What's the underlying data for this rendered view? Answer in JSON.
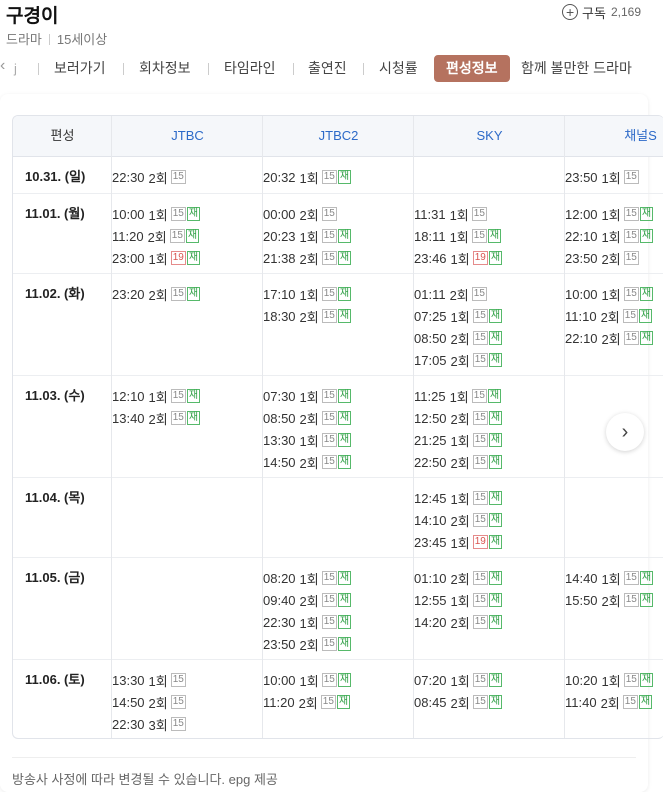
{
  "header": {
    "title": "구경이",
    "genre": "드라마",
    "rating": "15세이상",
    "subscribe_label": "구독",
    "subscribe_count": "2,169"
  },
  "tabs": [
    "보러가기",
    "회차정보",
    "타임라인",
    "출연진",
    "시청률",
    "편성정보",
    "함께 볼만한 드라마"
  ],
  "tab_left_partial": "j",
  "active_tab": "편성정보",
  "schedule": {
    "header_first": "편성",
    "channels": [
      "JTBC",
      "JTBC2",
      "SKY",
      "채널S"
    ],
    "rows": [
      {
        "date": "10.31. (일)",
        "cells": [
          [
            {
              "time": "22:30",
              "ep": "2회",
              "badges": [
                "15"
              ]
            }
          ],
          [
            {
              "time": "20:32",
              "ep": "1회",
              "badges": [
                "15",
                "재"
              ]
            }
          ],
          [],
          [
            {
              "time": "23:50",
              "ep": "1회",
              "badges": [
                "15"
              ]
            }
          ]
        ]
      },
      {
        "date": "11.01. (월)",
        "cells": [
          [
            {
              "time": "10:00",
              "ep": "1회",
              "badges": [
                "15",
                "재"
              ]
            },
            {
              "time": "11:20",
              "ep": "2회",
              "badges": [
                "15",
                "재"
              ]
            },
            {
              "time": "23:00",
              "ep": "1회",
              "badges": [
                "19",
                "재"
              ]
            }
          ],
          [
            {
              "time": "00:00",
              "ep": "2회",
              "badges": [
                "15"
              ]
            },
            {
              "time": "20:23",
              "ep": "1회",
              "badges": [
                "15",
                "재"
              ]
            },
            {
              "time": "21:38",
              "ep": "2회",
              "badges": [
                "15",
                "재"
              ]
            }
          ],
          [
            {
              "time": "11:31",
              "ep": "1회",
              "badges": [
                "15"
              ]
            },
            {
              "time": "18:11",
              "ep": "1회",
              "badges": [
                "15",
                "재"
              ]
            },
            {
              "time": "23:46",
              "ep": "1회",
              "badges": [
                "19",
                "재"
              ]
            }
          ],
          [
            {
              "time": "12:00",
              "ep": "1회",
              "badges": [
                "15",
                "재"
              ]
            },
            {
              "time": "22:10",
              "ep": "1회",
              "badges": [
                "15",
                "재"
              ]
            },
            {
              "time": "23:50",
              "ep": "2회",
              "badges": [
                "15"
              ]
            }
          ]
        ]
      },
      {
        "date": "11.02. (화)",
        "cells": [
          [
            {
              "time": "23:20",
              "ep": "2회",
              "badges": [
                "15",
                "재"
              ]
            }
          ],
          [
            {
              "time": "17:10",
              "ep": "1회",
              "badges": [
                "15",
                "재"
              ]
            },
            {
              "time": "18:30",
              "ep": "2회",
              "badges": [
                "15",
                "재"
              ]
            }
          ],
          [
            {
              "time": "01:11",
              "ep": "2회",
              "badges": [
                "15"
              ]
            },
            {
              "time": "07:25",
              "ep": "1회",
              "badges": [
                "15",
                "재"
              ]
            },
            {
              "time": "08:50",
              "ep": "2회",
              "badges": [
                "15",
                "재"
              ]
            },
            {
              "time": "17:05",
              "ep": "2회",
              "badges": [
                "15",
                "재"
              ]
            }
          ],
          [
            {
              "time": "10:00",
              "ep": "1회",
              "badges": [
                "15",
                "재"
              ]
            },
            {
              "time": "11:10",
              "ep": "2회",
              "badges": [
                "15",
                "재"
              ]
            },
            {
              "time": "22:10",
              "ep": "2회",
              "badges": [
                "15",
                "재"
              ]
            }
          ]
        ]
      },
      {
        "date": "11.03. (수)",
        "cells": [
          [
            {
              "time": "12:10",
              "ep": "1회",
              "badges": [
                "15",
                "재"
              ]
            },
            {
              "time": "13:40",
              "ep": "2회",
              "badges": [
                "15",
                "재"
              ]
            }
          ],
          [
            {
              "time": "07:30",
              "ep": "1회",
              "badges": [
                "15",
                "재"
              ]
            },
            {
              "time": "08:50",
              "ep": "2회",
              "badges": [
                "15",
                "재"
              ]
            },
            {
              "time": "13:30",
              "ep": "1회",
              "badges": [
                "15",
                "재"
              ]
            },
            {
              "time": "14:50",
              "ep": "2회",
              "badges": [
                "15",
                "재"
              ]
            }
          ],
          [
            {
              "time": "11:25",
              "ep": "1회",
              "badges": [
                "15",
                "재"
              ]
            },
            {
              "time": "12:50",
              "ep": "2회",
              "badges": [
                "15",
                "재"
              ]
            },
            {
              "time": "21:25",
              "ep": "1회",
              "badges": [
                "15",
                "재"
              ]
            },
            {
              "time": "22:50",
              "ep": "2회",
              "badges": [
                "15",
                "재"
              ]
            }
          ],
          []
        ]
      },
      {
        "date": "11.04. (목)",
        "cells": [
          [],
          [],
          [
            {
              "time": "12:45",
              "ep": "1회",
              "badges": [
                "15",
                "재"
              ]
            },
            {
              "time": "14:10",
              "ep": "2회",
              "badges": [
                "15",
                "재"
              ]
            },
            {
              "time": "23:45",
              "ep": "1회",
              "badges": [
                "19",
                "재"
              ]
            }
          ],
          []
        ]
      },
      {
        "date": "11.05. (금)",
        "cells": [
          [],
          [
            {
              "time": "08:20",
              "ep": "1회",
              "badges": [
                "15",
                "재"
              ]
            },
            {
              "time": "09:40",
              "ep": "2회",
              "badges": [
                "15",
                "재"
              ]
            },
            {
              "time": "22:30",
              "ep": "1회",
              "badges": [
                "15",
                "재"
              ]
            },
            {
              "time": "23:50",
              "ep": "2회",
              "badges": [
                "15",
                "재"
              ]
            }
          ],
          [
            {
              "time": "01:10",
              "ep": "2회",
              "badges": [
                "15",
                "재"
              ]
            },
            {
              "time": "12:55",
              "ep": "1회",
              "badges": [
                "15",
                "재"
              ]
            },
            {
              "time": "14:20",
              "ep": "2회",
              "badges": [
                "15",
                "재"
              ]
            }
          ],
          [
            {
              "time": "14:40",
              "ep": "1회",
              "badges": [
                "15",
                "재"
              ]
            },
            {
              "time": "15:50",
              "ep": "2회",
              "badges": [
                "15",
                "재"
              ]
            }
          ]
        ]
      },
      {
        "date": "11.06. (토)",
        "cells": [
          [
            {
              "time": "13:30",
              "ep": "1회",
              "badges": [
                "15"
              ]
            },
            {
              "time": "14:50",
              "ep": "2회",
              "badges": [
                "15"
              ]
            },
            {
              "time": "22:30",
              "ep": "3회",
              "badges": [
                "15"
              ]
            }
          ],
          [
            {
              "time": "10:00",
              "ep": "1회",
              "badges": [
                "15",
                "재"
              ]
            },
            {
              "time": "11:20",
              "ep": "2회",
              "badges": [
                "15",
                "재"
              ]
            }
          ],
          [
            {
              "time": "07:20",
              "ep": "1회",
              "badges": [
                "15",
                "재"
              ]
            },
            {
              "time": "08:45",
              "ep": "2회",
              "badges": [
                "15",
                "재"
              ]
            }
          ],
          [
            {
              "time": "10:20",
              "ep": "1회",
              "badges": [
                "15",
                "재"
              ]
            },
            {
              "time": "11:40",
              "ep": "2회",
              "badges": [
                "15",
                "재"
              ]
            }
          ]
        ]
      }
    ]
  },
  "footnote": "방송사 사정에 따라 변경될 수 있습니다. epg 제공",
  "icons": {
    "subscribe": "plus-circle-icon",
    "scroll_next": "chevron-right-icon",
    "tab_prev": "chevron-left-icon"
  },
  "colors": {
    "accent": "#b5725f",
    "channel_link": "#2d6ac8",
    "rerun_badge": "#2f9f45",
    "age19_badge": "#d9534f"
  }
}
